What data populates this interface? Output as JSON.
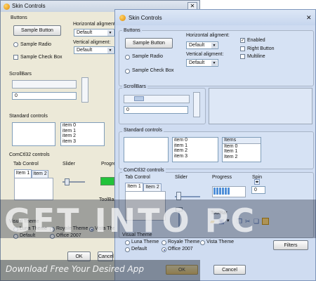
{
  "window_title": "Skin Controls",
  "groups": {
    "buttons": "Buttons",
    "scrollbars": "ScrollBars",
    "standard": "Standard controls",
    "comctl": "ComCtl32 controls",
    "visual_theme": "Visual Theme"
  },
  "buttons": {
    "sample_button": "Sample Button",
    "sample_radio": "Sample Radio",
    "sample_checkbox": "Sample Check Box",
    "horizontal_alignment_label": "Horizontal aligment:",
    "horizontal_alignment_value": "Default",
    "vertical_alignment_label": "Vertical aligment:",
    "vertical_alignment_value": "Default",
    "enabled": "Enabled",
    "enabled_checked": true,
    "right_button": "Right Button",
    "multiline": "Multiline"
  },
  "scrollbars": {
    "edit_value": "0"
  },
  "standard": {
    "list_items": [
      "item 0",
      "item 1",
      "item 2",
      "item 3"
    ],
    "list_items_back": [
      "item 0",
      "item 1",
      "item 2",
      "item 3"
    ],
    "listview_header": "Items",
    "listview_items": [
      "Item 0",
      "Item 1",
      "Item 2"
    ]
  },
  "comctl": {
    "tab_control_label": "Tab Control",
    "tabs": [
      "Item 1",
      "Item 2"
    ],
    "slider_label": "Slider",
    "progress_label": "Progress",
    "progress_fraction": 0.55,
    "spin_label": "Spin",
    "spin_value": "0",
    "toolbar_label": "ToolBar"
  },
  "theme": {
    "luna": "Luna Theme",
    "royale": "Royale Theme",
    "vista": "Vista Theme",
    "default": "Default",
    "office": "Office 2007",
    "selected": "office"
  },
  "actions": {
    "filters": "Filters",
    "ok": "OK",
    "cancel": "Cancel"
  },
  "watermark": {
    "main": "GET INTO PC",
    "sub": "Download Free Your Desired App"
  },
  "colors": {
    "front_bg": "#cfdcf1",
    "back_bg": "#ece9d8",
    "progress": "#4f8fd8"
  }
}
